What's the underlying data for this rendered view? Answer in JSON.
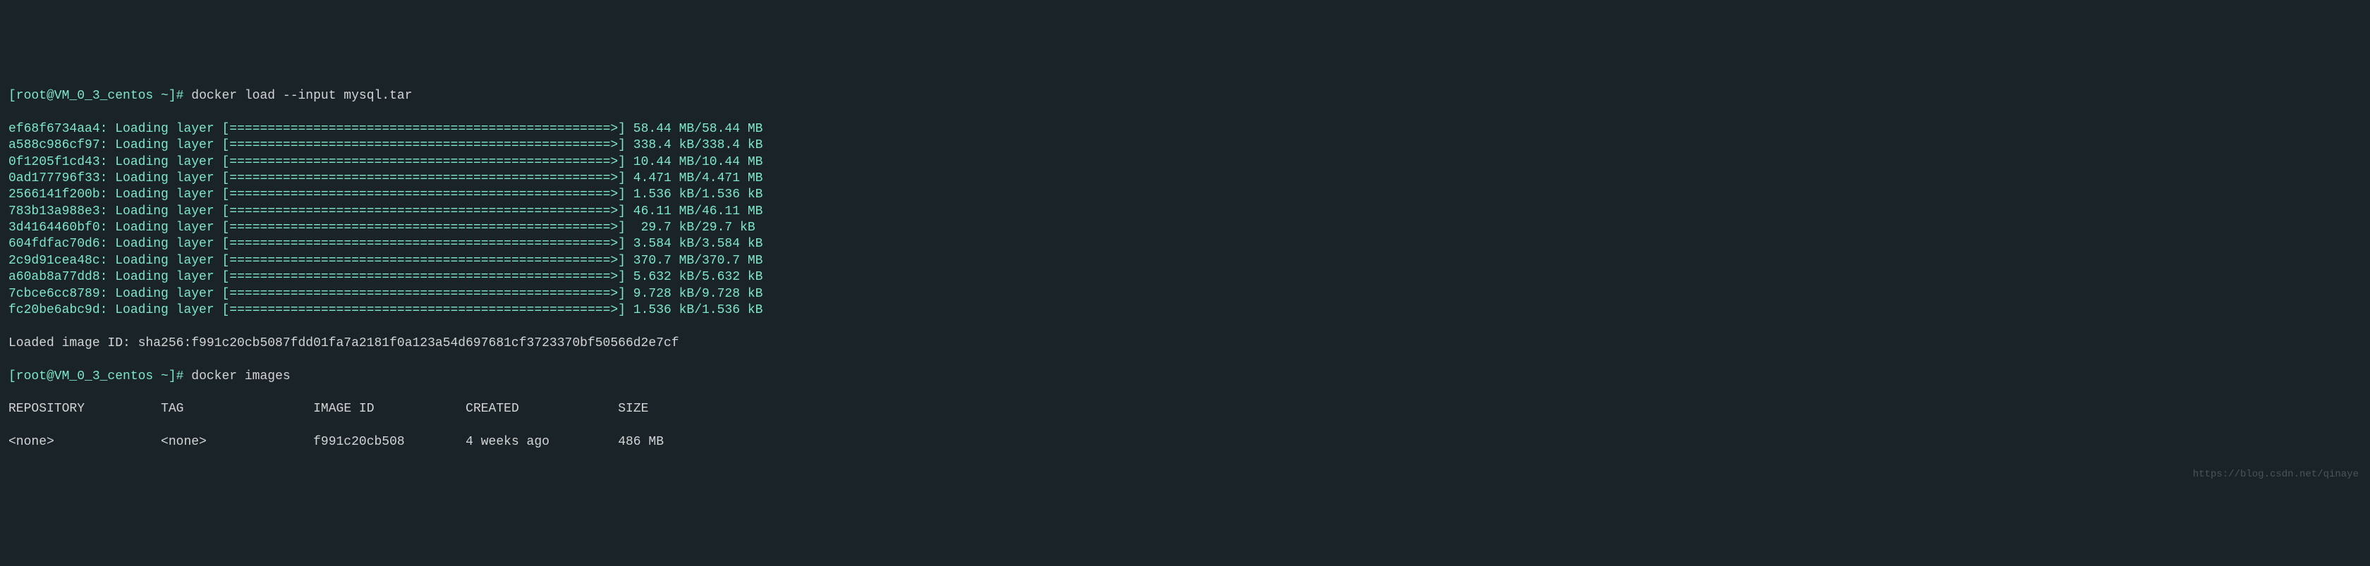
{
  "prompt1": {
    "user_host": "[root@VM_0_3_centos ~]#",
    "command": "docker load --input mysql.tar"
  },
  "layers": [
    {
      "id": "ef68f6734aa4",
      "status": "Loading layer",
      "bar": "[==================================================>]",
      "size": " 58.44 MB/58.44 MB"
    },
    {
      "id": "a588c986cf97",
      "status": "Loading layer",
      "bar": "[==================================================>]",
      "size": " 338.4 kB/338.4 kB"
    },
    {
      "id": "0f1205f1cd43",
      "status": "Loading layer",
      "bar": "[==================================================>]",
      "size": " 10.44 MB/10.44 MB"
    },
    {
      "id": "0ad177796f33",
      "status": "Loading layer",
      "bar": "[==================================================>]",
      "size": " 4.471 MB/4.471 MB"
    },
    {
      "id": "2566141f200b",
      "status": "Loading layer",
      "bar": "[==================================================>]",
      "size": " 1.536 kB/1.536 kB"
    },
    {
      "id": "783b13a988e3",
      "status": "Loading layer",
      "bar": "[==================================================>]",
      "size": " 46.11 MB/46.11 MB"
    },
    {
      "id": "3d4164460bf0",
      "status": "Loading layer",
      "bar": "[==================================================>]",
      "size": "  29.7 kB/29.7 kB"
    },
    {
      "id": "604fdfac70d6",
      "status": "Loading layer",
      "bar": "[==================================================>]",
      "size": " 3.584 kB/3.584 kB"
    },
    {
      "id": "2c9d91cea48c",
      "status": "Loading layer",
      "bar": "[==================================================>]",
      "size": " 370.7 MB/370.7 MB"
    },
    {
      "id": "a60ab8a77dd8",
      "status": "Loading layer",
      "bar": "[==================================================>]",
      "size": " 5.632 kB/5.632 kB"
    },
    {
      "id": "7cbce6cc8789",
      "status": "Loading layer",
      "bar": "[==================================================>]",
      "size": " 9.728 kB/9.728 kB"
    },
    {
      "id": "fc20be6abc9d",
      "status": "Loading layer",
      "bar": "[==================================================>]",
      "size": " 1.536 kB/1.536 kB"
    }
  ],
  "loaded_image": "Loaded image ID: sha256:f991c20cb5087fdd01fa7a2181f0a123a54d697681cf3723370bf50566d2e7cf",
  "prompt2": {
    "user_host": "[root@VM_0_3_centos ~]#",
    "command": "docker images"
  },
  "table": {
    "headers": {
      "repository": "REPOSITORY",
      "tag": "TAG",
      "image_id": "IMAGE ID",
      "created": "CREATED",
      "size": "SIZE"
    },
    "row": {
      "repository": "<none>",
      "tag": "<none>",
      "image_id": "f991c20cb508",
      "created": "4 weeks ago",
      "size": "486 MB"
    }
  },
  "watermark": "https://blog.csdn.net/qinaye"
}
